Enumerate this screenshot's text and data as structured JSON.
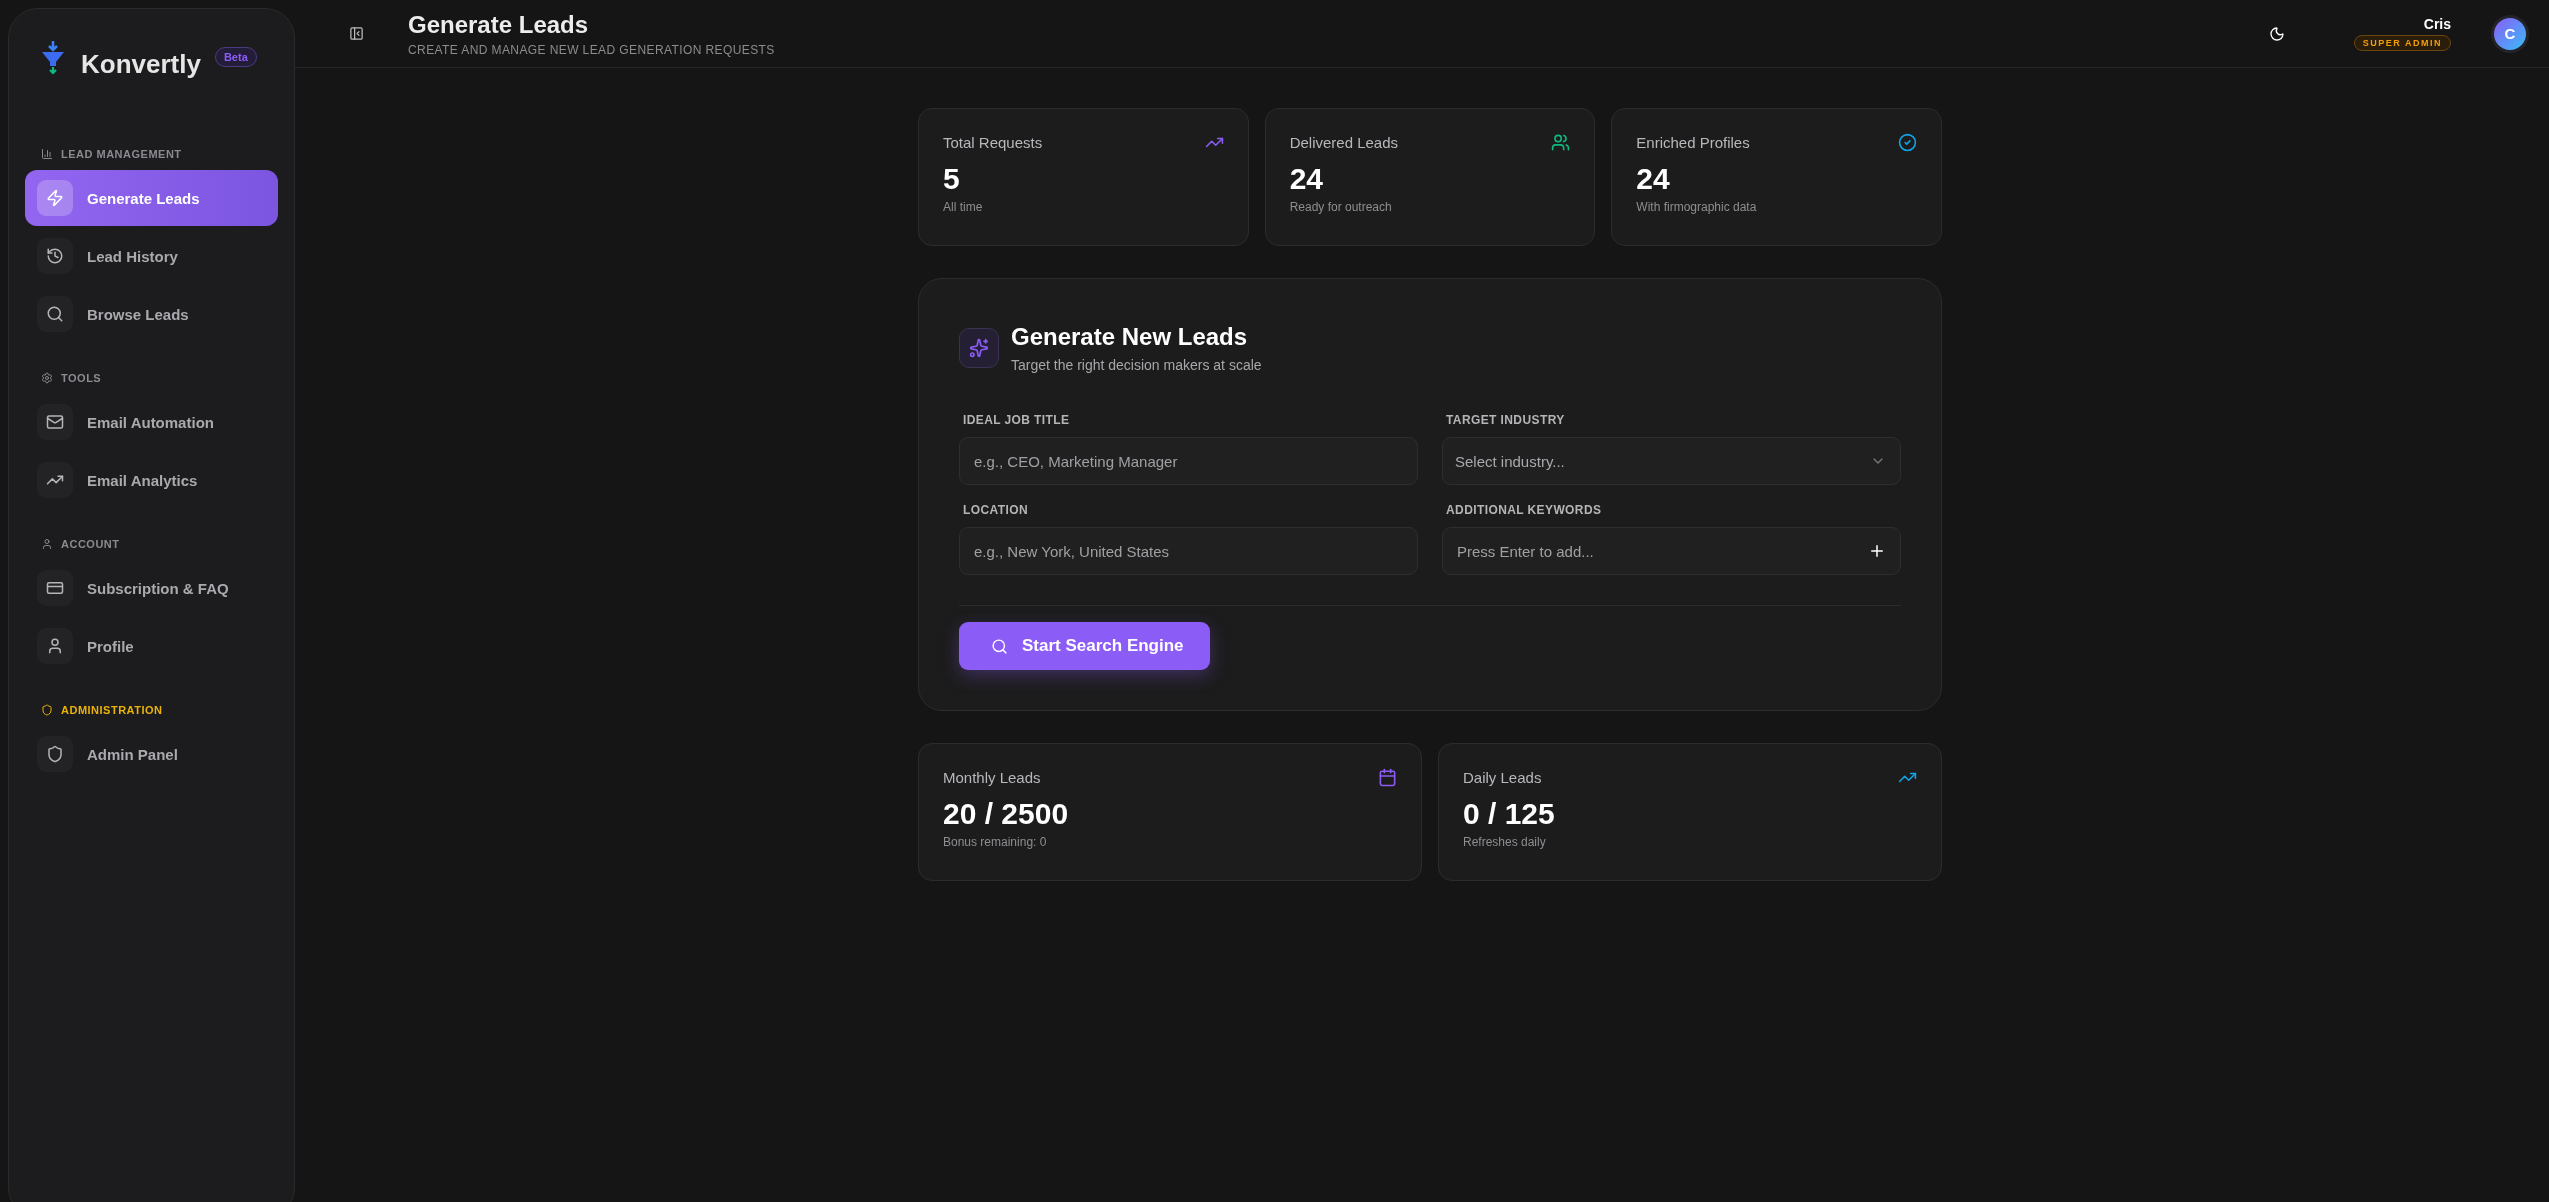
{
  "brand": {
    "name": "Konvertly",
    "badge": "Beta"
  },
  "sidebar": {
    "sections": [
      {
        "label": "LEAD MANAGEMENT",
        "color": "#8a8a90",
        "items": [
          {
            "label": "Generate Leads",
            "selected": true
          },
          {
            "label": "Lead History",
            "selected": false
          },
          {
            "label": "Browse Leads",
            "selected": false
          }
        ]
      },
      {
        "label": "TOOLS",
        "color": "#8a8a90",
        "items": [
          {
            "label": "Email Automation",
            "selected": false
          },
          {
            "label": "Email Analytics",
            "selected": false
          }
        ]
      },
      {
        "label": "ACCOUNT",
        "color": "#8a8a90",
        "items": [
          {
            "label": "Subscription & FAQ",
            "selected": false
          },
          {
            "label": "Profile",
            "selected": false
          }
        ]
      },
      {
        "label": "ADMINISTRATION",
        "color": "#eab308",
        "items": [
          {
            "label": "Admin Panel",
            "selected": false
          }
        ]
      }
    ]
  },
  "header": {
    "title": "Generate Leads",
    "subtitle": "CREATE AND MANAGE NEW LEAD GENERATION REQUESTS",
    "user": {
      "name": "Cris",
      "role": "SUPER ADMIN",
      "initial": "C"
    }
  },
  "stats": [
    {
      "label": "Total Requests",
      "value": "5",
      "note": "All time",
      "color": "#8b5cf6"
    },
    {
      "label": "Delivered Leads",
      "value": "24",
      "note": "Ready for outreach",
      "color": "#10b981"
    },
    {
      "label": "Enriched Profiles",
      "value": "24",
      "note": "With firmographic data",
      "color": "#0ea5e9"
    }
  ],
  "form": {
    "title": "Generate New Leads",
    "subtitle": "Target the right decision makers at scale",
    "fields": [
      {
        "kind": "text",
        "label": "IDEAL JOB TITLE",
        "placeholder": "e.g., CEO, Marketing Manager"
      },
      {
        "kind": "select",
        "label": "TARGET INDUSTRY",
        "placeholder": "Select industry..."
      },
      {
        "kind": "text",
        "label": "LOCATION",
        "placeholder": "e.g., New York, United States"
      },
      {
        "kind": "keywords",
        "label": "ADDITIONAL KEYWORDS",
        "placeholder": "Press Enter to add..."
      }
    ],
    "button": "Start Search Engine"
  },
  "usage": [
    {
      "label": "Monthly Leads",
      "value": "20 / 2500",
      "note": "Bonus remaining: 0",
      "color": "#8b5cf6"
    },
    {
      "label": "Daily Leads",
      "value": "0 / 125",
      "note": "Refreshes daily",
      "color": "#0ea5e9"
    }
  ]
}
